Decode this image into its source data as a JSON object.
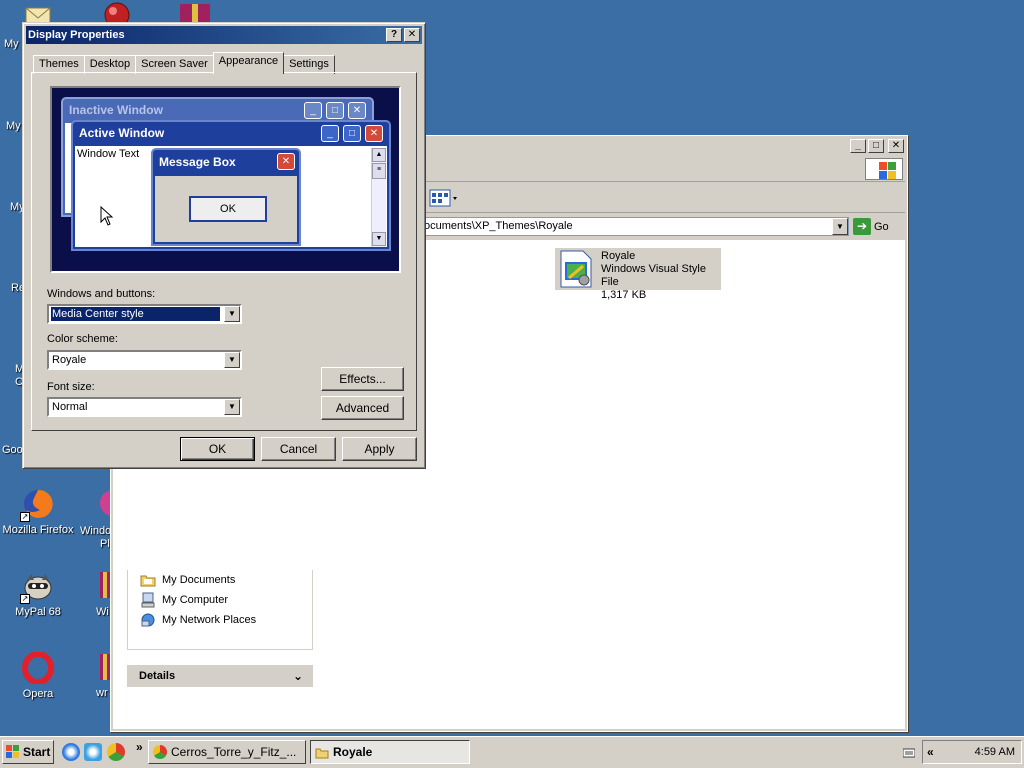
{
  "desktop": {
    "icons": [
      {
        "label": "Mozilla Firefox"
      },
      {
        "label": "MyPal 68"
      },
      {
        "label": "Opera"
      }
    ],
    "clipped_labels": [
      "My I",
      "My",
      "My",
      "Re",
      "M",
      "C",
      "Goo",
      "Windo",
      "Pl",
      "Wi",
      "wr"
    ]
  },
  "dialog": {
    "title": "Display Properties",
    "help_glyph": "?",
    "close_glyph": "✕",
    "tabs": [
      "Themes",
      "Desktop",
      "Screen Saver",
      "Appearance",
      "Settings"
    ],
    "active_tab": "Appearance",
    "preview": {
      "inactive_title": "Inactive Window",
      "active_title": "Active Window",
      "window_text": "Window Text",
      "message_title": "Message Box",
      "message_ok": "OK"
    },
    "windows_buttons_label": "Windows and buttons:",
    "windows_buttons_value": "Media Center style",
    "color_scheme_label": "Color scheme:",
    "color_scheme_value": "Royale",
    "font_size_label": "Font size:",
    "font_size_value": "Normal",
    "effects_button": "Effects...",
    "advanced_button": "Advanced",
    "ok_button": "OK",
    "cancel_button": "Cancel",
    "apply_button": "Apply"
  },
  "explorer": {
    "min_glyph": "_",
    "max_glyph": "□",
    "close_glyph": "✕",
    "address": "ocuments\\XP_Themes\\Royale",
    "go_label": "Go",
    "file": {
      "name": "Royale",
      "type": "Windows Visual Style File",
      "size": "1,317 KB"
    },
    "other_places": [
      "My Documents",
      "My Computer",
      "My Network Places"
    ],
    "details_header": "Details"
  },
  "taskbar": {
    "start_label": "Start",
    "chevron": "»",
    "tasks": [
      {
        "label": "Cerros_Torre_y_Fitz_..."
      },
      {
        "label": "Royale"
      }
    ],
    "tray_chevron": "«",
    "clock": "4:59 AM"
  },
  "colors": {
    "desktop": "#3a6ea5",
    "title_active": "#0a246a",
    "face": "#d4d0c8",
    "preview_bg": "#0a0f4a",
    "royale_blue": "#1f3f9c"
  }
}
